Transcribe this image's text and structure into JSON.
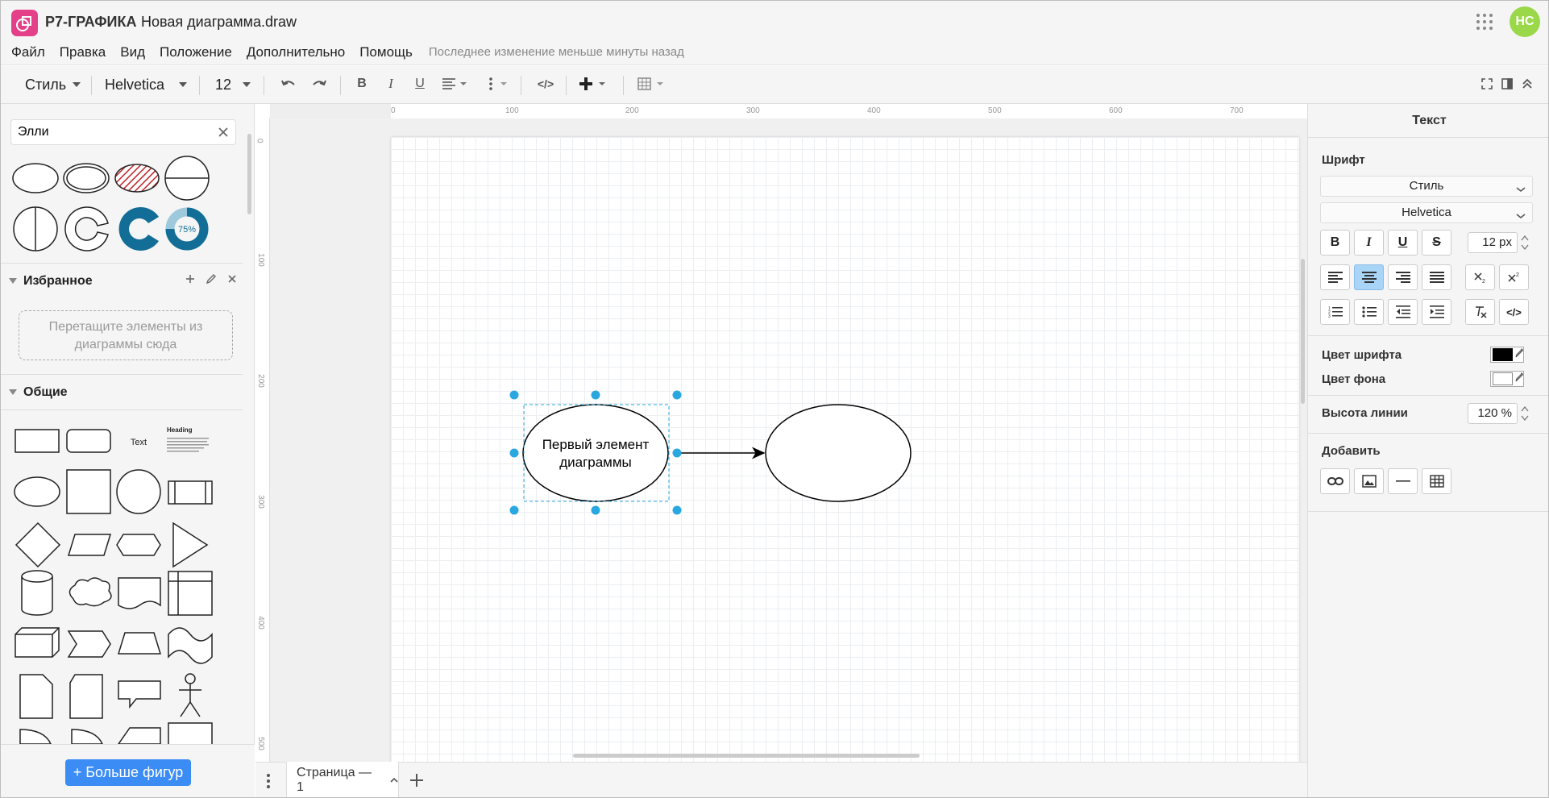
{
  "app": {
    "brand": "Р7-ГРАФИКА",
    "document": "Новая диаграмма.draw",
    "user_initials": "НС",
    "logo_color": "#e4408a",
    "avatar_color": "#9ad84a"
  },
  "menu": {
    "items": [
      "Файл",
      "Правка",
      "Вид",
      "Положение",
      "Дополнительно",
      "Помощь"
    ],
    "last_change": "Последнее изменение меньше минуты назад"
  },
  "toolbar": {
    "style_label": "Стиль",
    "font_name": "Helvetica",
    "font_size": "12"
  },
  "left_panel": {
    "search_value": "Элли",
    "favorites_title": "Избранное",
    "favorites_hint": "Перетащите элементы из диаграммы сюда",
    "general_title": "Общие",
    "shape_text": "Text",
    "shape_heading": "Heading",
    "donut_label": "75%",
    "more_shapes": "+ Больше фигур"
  },
  "rulers": {
    "h_labels": [
      "0",
      "100",
      "200",
      "300",
      "400",
      "500",
      "600",
      "700"
    ],
    "v_labels": [
      "0",
      "100",
      "200",
      "300",
      "400",
      "500"
    ]
  },
  "diagram": {
    "node1_line1": "Первый элемент",
    "node1_line2": "диаграммы",
    "selection_color": "#29a8e0"
  },
  "pages": {
    "current": "Страница — 1"
  },
  "right_panel": {
    "title": "Текст",
    "font_section": "Шрифт",
    "style_select": "Стиль",
    "font_select": "Helvetica",
    "font_size": "12 px",
    "font_color_label": "Цвет шрифта",
    "font_color": "#000000",
    "bg_color_label": "Цвет фона",
    "line_height_label": "Высота линии",
    "line_height": "120 %",
    "add_section": "Добавить"
  }
}
